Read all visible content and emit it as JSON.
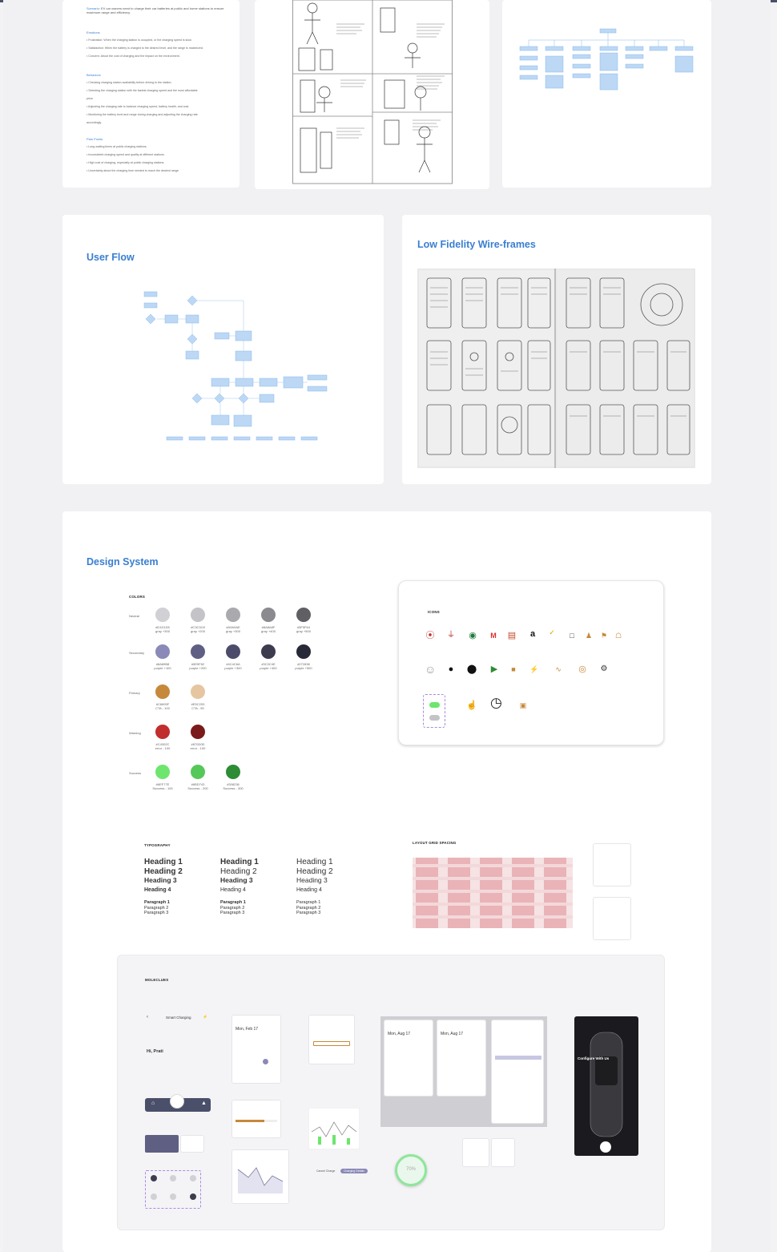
{
  "persona": {
    "scenario_label": "Scenario:",
    "scenario_text": "EV car owners need to charge their car batteries at public and home stations to ensure maximum range and efficiency.",
    "emotions_title": "Emotions",
    "emotions": [
      "• Frustration: When the charging station is occupied, or the charging speed is slow.",
      "• Satisfaction: When the battery is charged to the desired level, and the range is maximized.",
      "• Concern: About the cost of charging and the impact on the environment."
    ],
    "behaviors_title": "Behaviors",
    "behaviors": [
      "• Checking charging station availability before driving to the station.",
      "• Selecting the charging station with the fastest charging speed and the most affordable",
      "   price.",
      "• Adjusting the charging rate to balance charging speed, battery health, and cost.",
      "• Monitoring the battery level and range during charging and adjusting the charging rate",
      "   accordingly."
    ],
    "painpoints_title": "Pain Points",
    "painpoints": [
      "• Long waiting times at public charging stations.",
      "• Inconsistent charging speed and quality at different stations.",
      "• High cost of charging, especially at public charging stations.",
      "• Uncertainty about the charging time needed to reach the desired range."
    ]
  },
  "user_flow": {
    "title": "User Flow"
  },
  "wireframes": {
    "title": "Low Fidelity Wire-frames"
  },
  "design_system": {
    "title": "Design System",
    "colors": {
      "label": "COLORS",
      "rows": [
        {
          "label": "Neutral",
          "swatches": [
            {
              "hex": "#D1D1D5",
              "code": "#D1D1D5",
              "name": "gray +300"
            },
            {
              "hex": "#C3C3C8",
              "code": "#C3C3C8",
              "name": "gray +200"
            },
            {
              "hex": "#A9A9AE",
              "code": "#A9A9AE",
              "name": "gray +300"
            },
            {
              "hex": "#8A8A8F",
              "code": "#8A8A8F",
              "name": "gray +400"
            },
            {
              "hex": "#5F5F64",
              "code": "#5F5F64",
              "name": "gray +500"
            }
          ]
        },
        {
          "label": "Secondary",
          "swatches": [
            {
              "hex": "#8A89B8",
              "code": "#8A89B8",
              "name": "purple +100"
            },
            {
              "hex": "#5E5F82",
              "code": "#5E5F82",
              "name": "purple +200"
            },
            {
              "hex": "#4C4C6A",
              "code": "#4C4C6A",
              "name": "purple +300"
            },
            {
              "hex": "#3C3C4E",
              "code": "#3C3C4E",
              "name": "purple +400"
            },
            {
              "hex": "#272838",
              "code": "#272838",
              "name": "purple +500"
            }
          ]
        },
        {
          "label": "Primary",
          "swatches": [
            {
              "hex": "#C6893A",
              "code": "#C6893F",
              "name": "CTA - 100"
            },
            {
              "hex": "#E5C6A0",
              "code": "#E5C293",
              "name": "CTA - 50"
            }
          ]
        },
        {
          "label": "Warning",
          "swatches": [
            {
              "hex": "#C12E2E",
              "code": "#C4302C",
              "name": "error - 100"
            },
            {
              "hex": "#7A1A1A",
              "code": "#870D0D",
              "name": "error - 100"
            }
          ]
        },
        {
          "label": "Success",
          "swatches": [
            {
              "hex": "#6EE56E",
              "code": "#6EF77E",
              "name": "Success - 100"
            },
            {
              "hex": "#55C85A",
              "code": "#6BD743",
              "name": "Success - 200"
            },
            {
              "hex": "#2E8B36",
              "code": "#308236",
              "name": "Success - 300"
            }
          ]
        }
      ]
    },
    "icons_label": "ICONS",
    "typography": {
      "label": "TYPOGRAPHY",
      "headings": [
        "Heading 1",
        "Heading 2",
        "Heading 3",
        "Heading 4"
      ],
      "paragraphs": [
        "Paragraph 1",
        "Paragraph 2",
        "Paragraph 3"
      ]
    },
    "layout_label": "LAYOUT GRID SPACING",
    "molecules": {
      "label": "MOLECLUES",
      "smart_charging": "Smart Charging",
      "greeting": "Hi, Prati",
      "calendar1": "Mon, Feb 17",
      "calendar2": "Mon, Aug 17",
      "calendar3": "Mon, Aug 17",
      "progress": "70%",
      "cta_title": "Configure With Us",
      "btn_primary": "Cancel Charge",
      "btn_secondary": "Charging Details"
    }
  }
}
